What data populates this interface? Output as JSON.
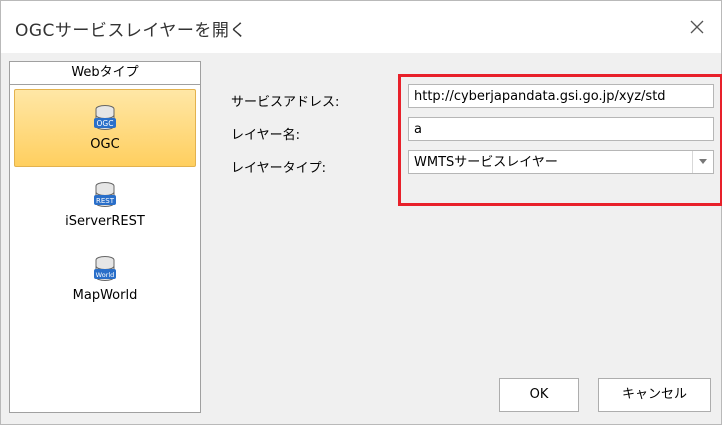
{
  "window": {
    "title": "OGCサービスレイヤーを開く",
    "close_icon": "close-icon"
  },
  "left_panel": {
    "header": "Webタイプ",
    "items": [
      {
        "label": "OGC",
        "icon": "database-ogc-icon",
        "badge": "OGC",
        "selected": true
      },
      {
        "label": "iServerREST",
        "icon": "database-rest-icon",
        "badge": "REST",
        "selected": false
      },
      {
        "label": "MapWorld",
        "icon": "database-world-icon",
        "badge": "World",
        "selected": false
      }
    ]
  },
  "form": {
    "service_address_label": "サービスアドレス:",
    "service_address_value": "http://cyberjapandata.gsi.go.jp/xyz/std",
    "layer_name_label": "レイヤー名:",
    "layer_name_value": "a",
    "layer_type_label": "レイヤータイプ:",
    "layer_type_value": "WMTSサービスレイヤー"
  },
  "buttons": {
    "ok": "OK",
    "cancel": "キャンセル"
  },
  "colors": {
    "highlight": "#e8202a",
    "selected_bg": "#ffd56e",
    "icon_blue": "#2a6fc9"
  }
}
